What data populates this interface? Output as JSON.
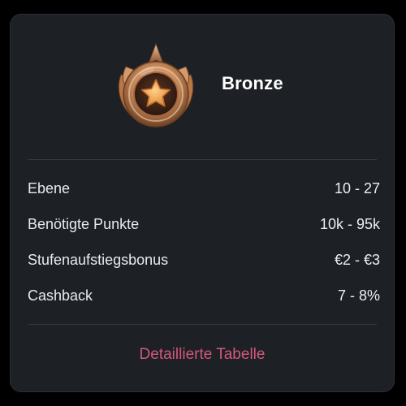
{
  "tier": {
    "name": "Bronze",
    "badge_icon": "bronze-star-medal-icon",
    "colors": {
      "bronze_light": "#e8b58a",
      "bronze_mid": "#c58656",
      "bronze_dark": "#7a4a2c",
      "star": "#f2a24a"
    }
  },
  "rows": [
    {
      "label": "Ebene",
      "value": "10 - 27"
    },
    {
      "label": "Benötigte Punkte",
      "value": "10k - 95k"
    },
    {
      "label": "Stufenaufstiegsbonus",
      "value": "€2 - €3"
    },
    {
      "label": "Cashback",
      "value": "7 - 8%"
    }
  ],
  "details_link": {
    "label": "Detaillierte Tabelle",
    "color": "#d4577a"
  },
  "colors": {
    "page_bg": "#000000",
    "card_bg": "#1d2025",
    "text": "#e9eaec",
    "divider": "#353a42"
  }
}
